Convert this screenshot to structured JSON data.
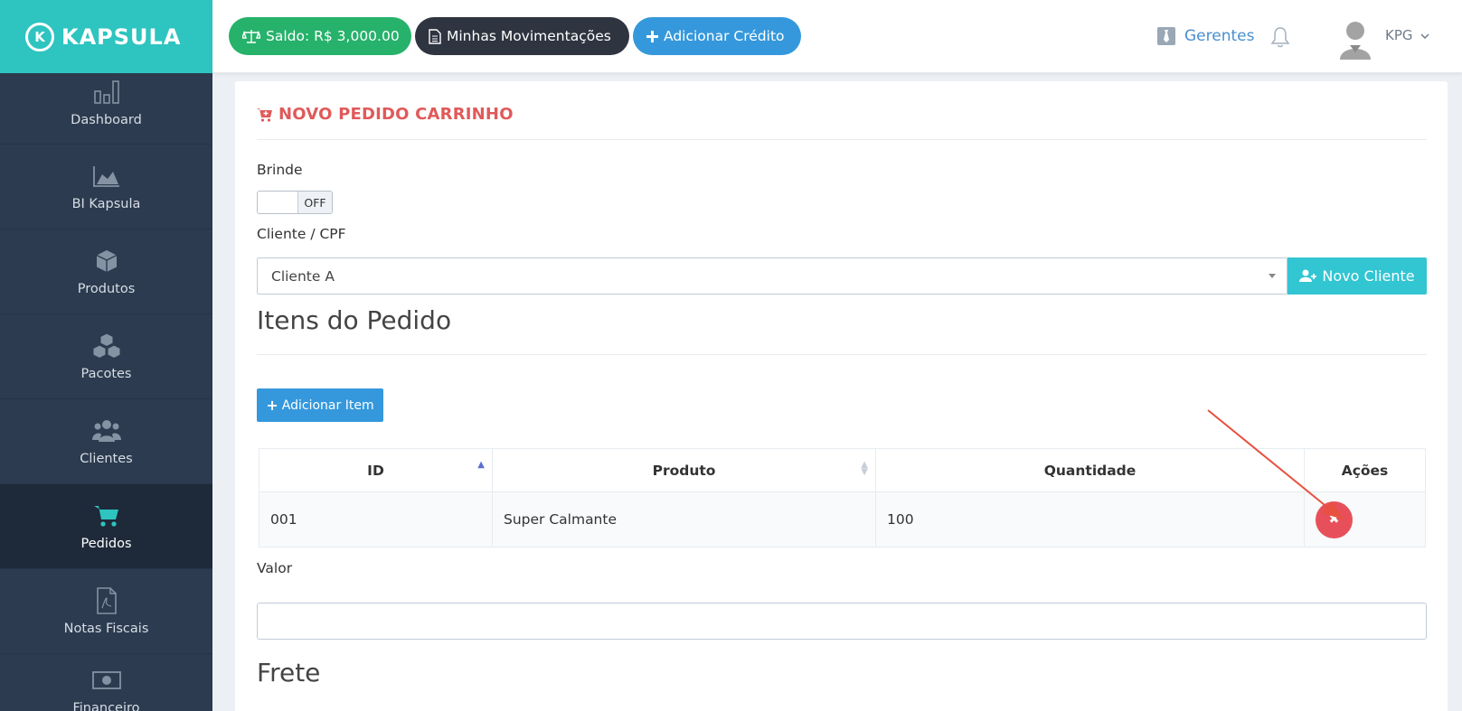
{
  "brand": {
    "name": "KAPSULA",
    "mark": "K"
  },
  "sidebar": {
    "items": [
      {
        "label": "Dashboard",
        "icon": "bar-chart-icon"
      },
      {
        "label": "BI Kapsula",
        "icon": "area-chart-icon"
      },
      {
        "label": "Produtos",
        "icon": "cube-icon"
      },
      {
        "label": "Pacotes",
        "icon": "cubes-icon"
      },
      {
        "label": "Clientes",
        "icon": "users-icon"
      },
      {
        "label": "Pedidos",
        "icon": "cart-icon"
      },
      {
        "label": "Notas Fiscais",
        "icon": "pdf-file-icon"
      },
      {
        "label": "Financeiro",
        "icon": "money-icon"
      }
    ]
  },
  "topbar": {
    "saldo_label": "Saldo: R$ 3,000.00",
    "movimentacoes_label": "Minhas Movimentações",
    "add_credito_label": "Adicionar Crédito",
    "gerentes_label": "Gerentes",
    "user_name": "KPG"
  },
  "form": {
    "title": "NOVO PEDIDO CARRINHO",
    "brinde_label": "Brinde",
    "toggle_state": "OFF",
    "cliente_label": "Cliente / CPF",
    "cliente_value": "Cliente A",
    "novo_cliente_label": "Novo Cliente",
    "itens_title": "Itens do Pedido",
    "add_item_label": "Adicionar Item",
    "valor_label": "Valor",
    "valor_value": "",
    "frete_title": "Frete"
  },
  "table": {
    "headers": [
      "ID",
      "Produto",
      "Quantidade",
      "Ações"
    ],
    "rows": [
      {
        "id": "001",
        "produto": "Super Calmante",
        "quantidade": "100"
      }
    ]
  },
  "colors": {
    "brand_teal": "#2ec4c0",
    "sidebar_bg": "#2c3b4f",
    "saldo_green": "#26b26b",
    "primary_blue": "#3598dc",
    "title_red": "#e05a5a",
    "delete_red": "#e7505a",
    "cyan_button": "#32c5d2"
  }
}
